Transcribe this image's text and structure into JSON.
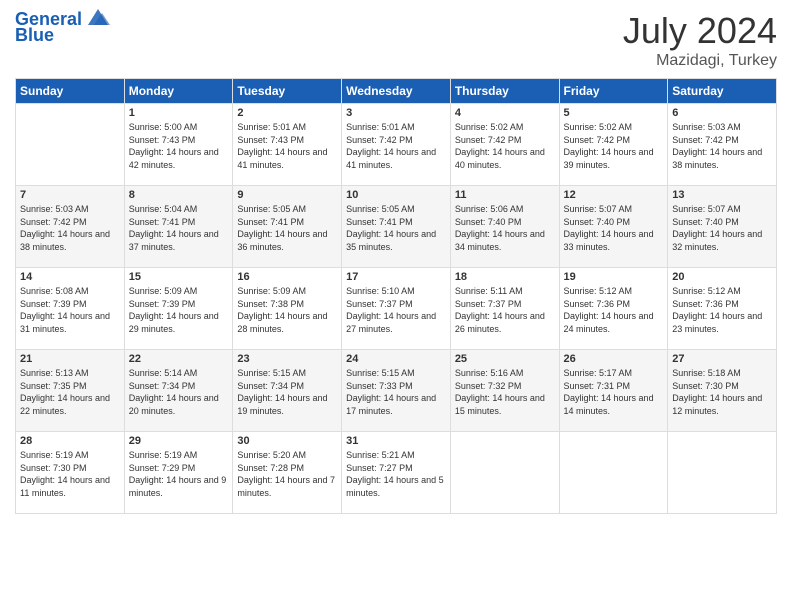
{
  "header": {
    "logo_line1": "General",
    "logo_line2": "Blue",
    "month": "July 2024",
    "location": "Mazidagi, Turkey"
  },
  "columns": [
    "Sunday",
    "Monday",
    "Tuesday",
    "Wednesday",
    "Thursday",
    "Friday",
    "Saturday"
  ],
  "weeks": [
    [
      {
        "day": "",
        "sunrise": "",
        "sunset": "",
        "daylight": ""
      },
      {
        "day": "1",
        "sunrise": "Sunrise: 5:00 AM",
        "sunset": "Sunset: 7:43 PM",
        "daylight": "Daylight: 14 hours and 42 minutes."
      },
      {
        "day": "2",
        "sunrise": "Sunrise: 5:01 AM",
        "sunset": "Sunset: 7:43 PM",
        "daylight": "Daylight: 14 hours and 41 minutes."
      },
      {
        "day": "3",
        "sunrise": "Sunrise: 5:01 AM",
        "sunset": "Sunset: 7:42 PM",
        "daylight": "Daylight: 14 hours and 41 minutes."
      },
      {
        "day": "4",
        "sunrise": "Sunrise: 5:02 AM",
        "sunset": "Sunset: 7:42 PM",
        "daylight": "Daylight: 14 hours and 40 minutes."
      },
      {
        "day": "5",
        "sunrise": "Sunrise: 5:02 AM",
        "sunset": "Sunset: 7:42 PM",
        "daylight": "Daylight: 14 hours and 39 minutes."
      },
      {
        "day": "6",
        "sunrise": "Sunrise: 5:03 AM",
        "sunset": "Sunset: 7:42 PM",
        "daylight": "Daylight: 14 hours and 38 minutes."
      }
    ],
    [
      {
        "day": "7",
        "sunrise": "Sunrise: 5:03 AM",
        "sunset": "Sunset: 7:42 PM",
        "daylight": "Daylight: 14 hours and 38 minutes."
      },
      {
        "day": "8",
        "sunrise": "Sunrise: 5:04 AM",
        "sunset": "Sunset: 7:41 PM",
        "daylight": "Daylight: 14 hours and 37 minutes."
      },
      {
        "day": "9",
        "sunrise": "Sunrise: 5:05 AM",
        "sunset": "Sunset: 7:41 PM",
        "daylight": "Daylight: 14 hours and 36 minutes."
      },
      {
        "day": "10",
        "sunrise": "Sunrise: 5:05 AM",
        "sunset": "Sunset: 7:41 PM",
        "daylight": "Daylight: 14 hours and 35 minutes."
      },
      {
        "day": "11",
        "sunrise": "Sunrise: 5:06 AM",
        "sunset": "Sunset: 7:40 PM",
        "daylight": "Daylight: 14 hours and 34 minutes."
      },
      {
        "day": "12",
        "sunrise": "Sunrise: 5:07 AM",
        "sunset": "Sunset: 7:40 PM",
        "daylight": "Daylight: 14 hours and 33 minutes."
      },
      {
        "day": "13",
        "sunrise": "Sunrise: 5:07 AM",
        "sunset": "Sunset: 7:40 PM",
        "daylight": "Daylight: 14 hours and 32 minutes."
      }
    ],
    [
      {
        "day": "14",
        "sunrise": "Sunrise: 5:08 AM",
        "sunset": "Sunset: 7:39 PM",
        "daylight": "Daylight: 14 hours and 31 minutes."
      },
      {
        "day": "15",
        "sunrise": "Sunrise: 5:09 AM",
        "sunset": "Sunset: 7:39 PM",
        "daylight": "Daylight: 14 hours and 29 minutes."
      },
      {
        "day": "16",
        "sunrise": "Sunrise: 5:09 AM",
        "sunset": "Sunset: 7:38 PM",
        "daylight": "Daylight: 14 hours and 28 minutes."
      },
      {
        "day": "17",
        "sunrise": "Sunrise: 5:10 AM",
        "sunset": "Sunset: 7:37 PM",
        "daylight": "Daylight: 14 hours and 27 minutes."
      },
      {
        "day": "18",
        "sunrise": "Sunrise: 5:11 AM",
        "sunset": "Sunset: 7:37 PM",
        "daylight": "Daylight: 14 hours and 26 minutes."
      },
      {
        "day": "19",
        "sunrise": "Sunrise: 5:12 AM",
        "sunset": "Sunset: 7:36 PM",
        "daylight": "Daylight: 14 hours and 24 minutes."
      },
      {
        "day": "20",
        "sunrise": "Sunrise: 5:12 AM",
        "sunset": "Sunset: 7:36 PM",
        "daylight": "Daylight: 14 hours and 23 minutes."
      }
    ],
    [
      {
        "day": "21",
        "sunrise": "Sunrise: 5:13 AM",
        "sunset": "Sunset: 7:35 PM",
        "daylight": "Daylight: 14 hours and 22 minutes."
      },
      {
        "day": "22",
        "sunrise": "Sunrise: 5:14 AM",
        "sunset": "Sunset: 7:34 PM",
        "daylight": "Daylight: 14 hours and 20 minutes."
      },
      {
        "day": "23",
        "sunrise": "Sunrise: 5:15 AM",
        "sunset": "Sunset: 7:34 PM",
        "daylight": "Daylight: 14 hours and 19 minutes."
      },
      {
        "day": "24",
        "sunrise": "Sunrise: 5:15 AM",
        "sunset": "Sunset: 7:33 PM",
        "daylight": "Daylight: 14 hours and 17 minutes."
      },
      {
        "day": "25",
        "sunrise": "Sunrise: 5:16 AM",
        "sunset": "Sunset: 7:32 PM",
        "daylight": "Daylight: 14 hours and 15 minutes."
      },
      {
        "day": "26",
        "sunrise": "Sunrise: 5:17 AM",
        "sunset": "Sunset: 7:31 PM",
        "daylight": "Daylight: 14 hours and 14 minutes."
      },
      {
        "day": "27",
        "sunrise": "Sunrise: 5:18 AM",
        "sunset": "Sunset: 7:30 PM",
        "daylight": "Daylight: 14 hours and 12 minutes."
      }
    ],
    [
      {
        "day": "28",
        "sunrise": "Sunrise: 5:19 AM",
        "sunset": "Sunset: 7:30 PM",
        "daylight": "Daylight: 14 hours and 11 minutes."
      },
      {
        "day": "29",
        "sunrise": "Sunrise: 5:19 AM",
        "sunset": "Sunset: 7:29 PM",
        "daylight": "Daylight: 14 hours and 9 minutes."
      },
      {
        "day": "30",
        "sunrise": "Sunrise: 5:20 AM",
        "sunset": "Sunset: 7:28 PM",
        "daylight": "Daylight: 14 hours and 7 minutes."
      },
      {
        "day": "31",
        "sunrise": "Sunrise: 5:21 AM",
        "sunset": "Sunset: 7:27 PM",
        "daylight": "Daylight: 14 hours and 5 minutes."
      },
      {
        "day": "",
        "sunrise": "",
        "sunset": "",
        "daylight": ""
      },
      {
        "day": "",
        "sunrise": "",
        "sunset": "",
        "daylight": ""
      },
      {
        "day": "",
        "sunrise": "",
        "sunset": "",
        "daylight": ""
      }
    ]
  ]
}
